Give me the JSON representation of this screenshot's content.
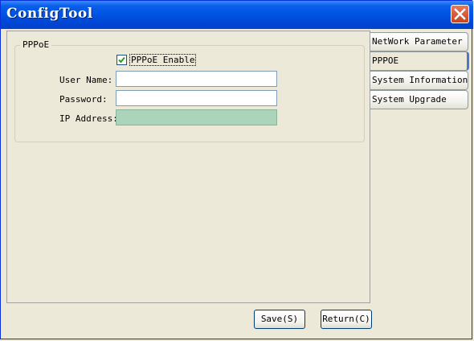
{
  "window": {
    "title": "ConfigTool"
  },
  "group": {
    "legend": "PPPoE"
  },
  "pppoe_enable": {
    "label": "PPPoE Enable",
    "checked": true
  },
  "fields": {
    "username": {
      "label": "User Name:",
      "value": ""
    },
    "password": {
      "label": "Password:",
      "value": ""
    },
    "ip_address": {
      "label": "IP Address:",
      "value": ""
    }
  },
  "tabs": [
    {
      "label": "NetWork Parameter",
      "selected": false
    },
    {
      "label": "PPPOE",
      "selected": true
    },
    {
      "label": "System Information",
      "selected": false
    },
    {
      "label": "System Upgrade",
      "selected": false
    }
  ],
  "buttons": {
    "save": "Save(S)",
    "return": "Return(C)"
  },
  "colors": {
    "titlebar": "#0055e5",
    "ip_field_bg": "#acd4ba",
    "close_button": "#d5522e"
  }
}
